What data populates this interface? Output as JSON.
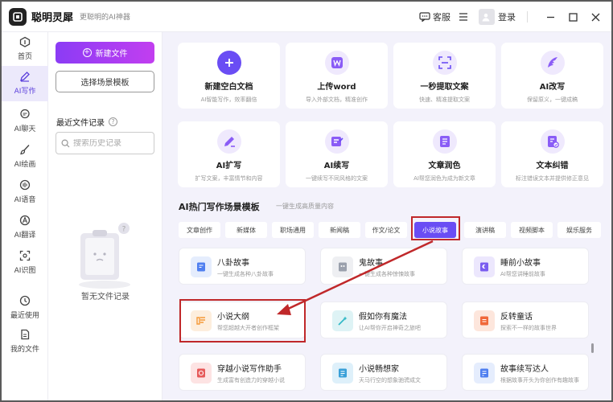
{
  "app": {
    "name": "聪明灵犀",
    "slogan": "更聪明的AI神器"
  },
  "titlebar": {
    "service_label": "客服",
    "login_label": "登录"
  },
  "rail": [
    {
      "label": "首页",
      "icon": "home-icon"
    },
    {
      "label": "AI写作",
      "icon": "pen-icon",
      "active": true
    },
    {
      "label": "AI聊天",
      "icon": "chat-icon"
    },
    {
      "label": "AI绘画",
      "icon": "brush-icon"
    },
    {
      "label": "AI语音",
      "icon": "voice-icon"
    },
    {
      "label": "AI翻译",
      "icon": "translate-icon"
    },
    {
      "label": "AI识图",
      "icon": "scan-icon"
    },
    {
      "label": "最近使用",
      "icon": "history-icon"
    },
    {
      "label": "我的文件",
      "icon": "file-icon"
    }
  ],
  "panel": {
    "new_button": "新建文件",
    "template_button": "选择场景模板",
    "recent_title": "最近文件记录",
    "search_placeholder": "搜索历史记录",
    "empty_text": "暂无文件记录"
  },
  "tools": [
    {
      "title": "新建空白文档",
      "subtitle": "AI智能写作，效率翻倍",
      "icon": "plus-icon",
      "color": "#6a4df4"
    },
    {
      "title": "上传word",
      "subtitle": "导入外部文档，精准创作",
      "icon": "word-icon",
      "color": "#8a5cf6"
    },
    {
      "title": "一秒提取文案",
      "subtitle": "快速、精准提取文案",
      "icon": "extract-icon",
      "color": "#6a4df4"
    },
    {
      "title": "AI改写",
      "subtitle": "保留原义，一键成稿",
      "icon": "feather-icon",
      "color": "#8a5cf6"
    },
    {
      "title": "AI扩写",
      "subtitle": "扩写文案，丰富情节和内容",
      "icon": "expand-icon",
      "color": "#8a5cf6"
    },
    {
      "title": "AI续写",
      "subtitle": "一键续写不同风格的文案",
      "icon": "continue-icon",
      "color": "#8a5cf6"
    },
    {
      "title": "文章润色",
      "subtitle": "AI帮您润色为成为新文章",
      "icon": "polish-icon",
      "color": "#8a5cf6"
    },
    {
      "title": "文本纠错",
      "subtitle": "标注错误文本并提供修正意见",
      "icon": "correct-icon",
      "color": "#8a5cf6"
    }
  ],
  "templates": {
    "title": "AI热门写作场景模板",
    "subtitle": "一键生成高质量内容",
    "tabs": [
      "文章创作",
      "新媒体",
      "职场通用",
      "新闻稿",
      "作文/论文",
      "小说故事",
      "演讲稿",
      "视频脚本",
      "娱乐服务"
    ],
    "active_tab": 5
  },
  "stories": [
    {
      "title": "八卦故事",
      "subtitle": "一键生成各种八卦故事",
      "icon": "book-icon",
      "color": "#4f7ff0"
    },
    {
      "title": "鬼故事",
      "subtitle": "一键生成各种惊悚故事",
      "icon": "ghost-icon",
      "color": "#9aa0ac"
    },
    {
      "title": "睡前小故事",
      "subtitle": "AI帮您讲睡前故事",
      "icon": "moon-book-icon",
      "color": "#7a5cf0"
    },
    {
      "title": "小说大纲",
      "subtitle": "帮您超越大开者创作框架",
      "icon": "outline-icon",
      "color": "#f59a3a"
    },
    {
      "title": "假如你有魔法",
      "subtitle": "让AI帮你开启神奇之旅吧",
      "icon": "magic-icon",
      "color": "#2fb8c6"
    },
    {
      "title": "反转童话",
      "subtitle": "探索不一样的故事世界",
      "icon": "fairytale-icon",
      "color": "#f0683a"
    },
    {
      "title": "穿越小说写作助手",
      "subtitle": "生成富有创造力的穿越小说",
      "icon": "time-travel-icon",
      "color": "#e65a5a"
    },
    {
      "title": "小说畅想家",
      "subtitle": "天马行空的想象驰骋成文",
      "icon": "imagine-icon",
      "color": "#3aa0d8"
    },
    {
      "title": "故事续写达人",
      "subtitle": "根据故事开头为你创作有趣故事",
      "icon": "story-continue-icon",
      "color": "#4f7ff0"
    }
  ]
}
